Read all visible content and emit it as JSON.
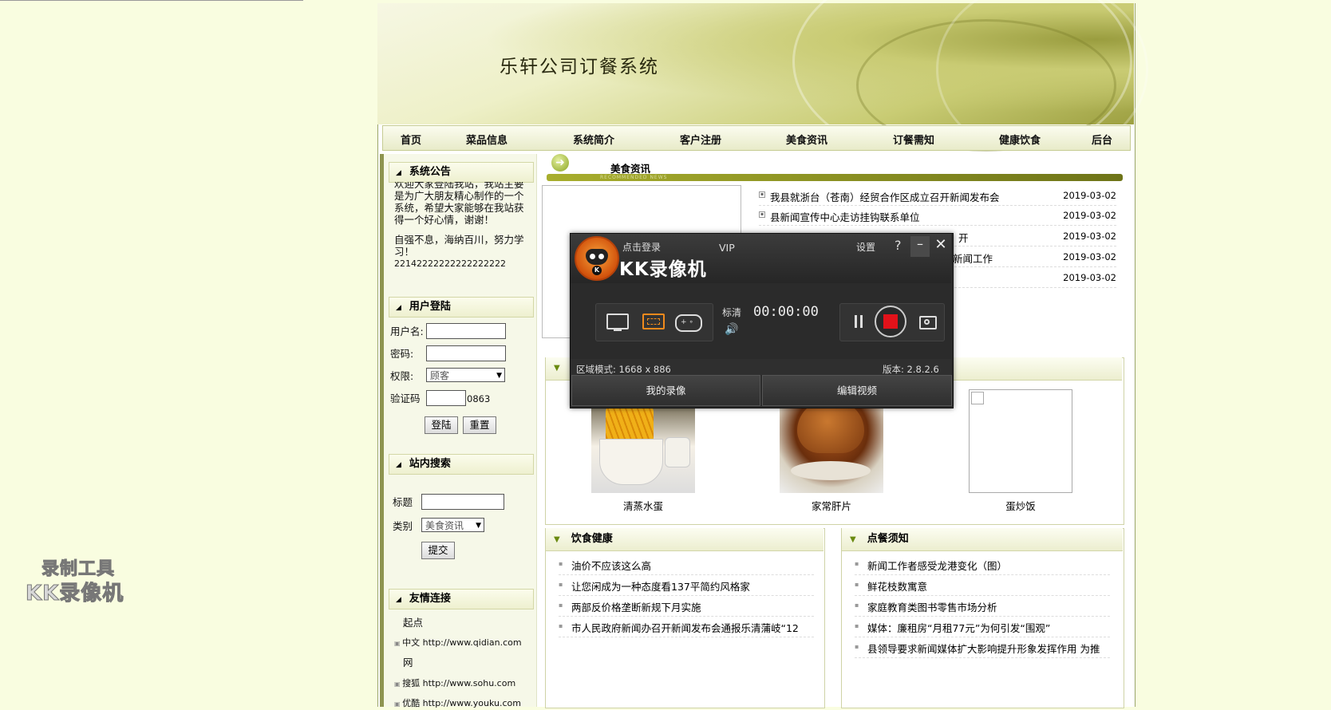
{
  "site": {
    "title": "乐轩公司订餐系统"
  },
  "nav": [
    "首页",
    "菜品信息",
    "系统简介",
    "客户注册",
    "美食资讯",
    "订餐需知",
    "健康饮食",
    "后台"
  ],
  "announcement": {
    "title": "系统公告",
    "lines": [
      "欢迎大家登陆我站，我站主要",
      "是为广大朋友精心制作的一个",
      "系统，希望大家能够在我站获",
      "得一个好心情，谢谢！",
      "",
      "自强不息，海纳百川，努力学",
      "习！",
      "22142222222222222222"
    ]
  },
  "login": {
    "title": "用户登陆",
    "username_label": "用户名:",
    "password_label": "密码:",
    "role_label": "权限:",
    "role_value": "顾客",
    "captcha_label": "验证码",
    "captcha_code": "0863",
    "login_btn": "登陆",
    "reset_btn": "重置"
  },
  "search": {
    "title": "站内搜索",
    "title_label": "标题",
    "category_label": "类别",
    "category_value": "美食资讯",
    "submit_btn": "提交"
  },
  "links": {
    "title": "友情连接",
    "items": [
      "起点",
      "中文 http://www.qidian.com",
      "网",
      "搜狐 http://www.sohu.com",
      "优酷 http://www.youku.com"
    ]
  },
  "news": {
    "title": "美食资讯",
    "subtitle": "RECOMMENDED NEWS",
    "items": [
      {
        "title": "我县就浙台（苍南）经贸合作区成立召开新闻发布会",
        "date": "2019-03-02"
      },
      {
        "title": "县新闻宣传中心走访挂钩联系单位",
        "date": "2019-03-02"
      },
      {
        "title": "开",
        "date": "2019-03-02"
      },
      {
        "title": "新闻工作",
        "date": "2019-03-02"
      },
      {
        "title": "",
        "date": "2019-03-02"
      }
    ]
  },
  "dishes": [
    {
      "name": "清蒸水蛋"
    },
    {
      "name": "家常肝片"
    },
    {
      "name": "蛋炒饭"
    }
  ],
  "health": {
    "title": "饮食健康",
    "items": [
      "油价不应该这么高",
      "让您闲成为一种态度看137平简约风格家",
      "两部反价格垄断新规下月实施",
      "市人民政府新闻办召开新闻发布会通报乐清蒲岐“12"
    ]
  },
  "notice": {
    "title": "点餐须知",
    "items": [
      "新闻工作者感受龙港变化（图）",
      "鲜花枝数寓意",
      "家庭教育类图书零售市场分析",
      "媒体：廉租房“月租77元”为何引发“围观”",
      "县领导要求新闻媒体扩大影响提升形象发挥作用  为推"
    ]
  },
  "recorder": {
    "login": "点击登录",
    "vip": "VIP",
    "settings": "设置",
    "help": "?",
    "name": "KK录像机",
    "quality": "标清",
    "time": "00:00:00",
    "mode": "区域模式: 1668 x 886",
    "version": "版本: 2.8.2.6",
    "my_videos": "我的录像",
    "edit_video": "编辑视频"
  },
  "watermark": {
    "line1": "录制工具",
    "line2": "KK录像机"
  }
}
